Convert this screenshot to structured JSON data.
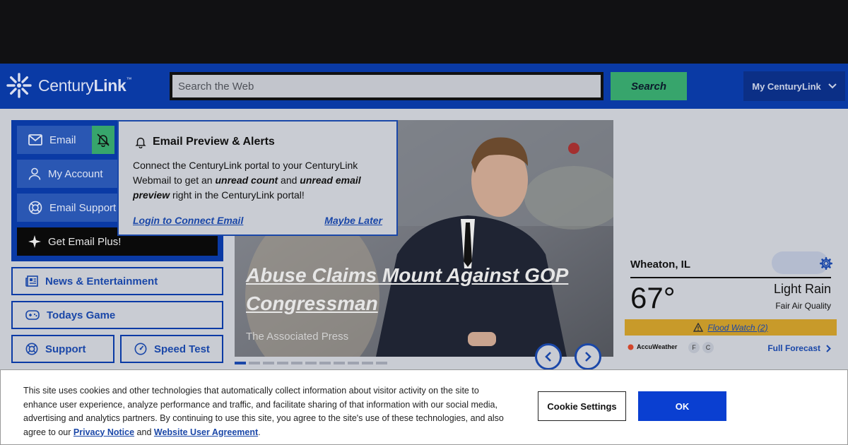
{
  "header": {
    "logo_text_light": "Century",
    "logo_text_bold": "Link",
    "logo_tm": "™",
    "search_placeholder": "Search the Web",
    "search_button": "Search",
    "account_menu": "My CenturyLink"
  },
  "left_panel": {
    "email": "Email",
    "my_account": "My Account",
    "email_support": "Email Support",
    "get_email_plus": "Get Email Plus!"
  },
  "quick_links": {
    "news": "News & Entertainment",
    "game": "Todays Game",
    "support": "Support",
    "speed_test": "Speed Test"
  },
  "email_popover": {
    "title": "Email Preview & Alerts",
    "body_1": "Connect the CenturyLink portal to your CenturyLink Webmail to get an ",
    "body_bold_1": "unread count",
    "body_2": " and ",
    "body_bold_2": "unread email preview",
    "body_3": " right in the CenturyLink portal!",
    "login_link": "Login to Connect Email",
    "later_link": "Maybe Later"
  },
  "hero": {
    "headline": "Abuse Claims Mount Against GOP Congressman",
    "source": "The Associated Press",
    "slide_count": 11,
    "active_slide": 1
  },
  "weather": {
    "location": "Wheaton, IL",
    "temperature": "67°",
    "condition": "Light Rain",
    "air_quality": "Fair Air Quality",
    "alert": "Flood Watch (2)",
    "provider": "AccuWeather",
    "unit_f": "F",
    "unit_c": "C",
    "full_forecast": "Full Forecast"
  },
  "cookie_banner": {
    "text": "This site uses cookies and other technologies that automatically collect information about visitor activity on the site to enhance user experience, analyze performance and traffic, and facilitate sharing of that information with our social media, advertising and analytics partners. By continuing to use this site, you agree to the site's use of these technologies, and also agree to our ",
    "privacy_link": "Privacy Notice",
    "and": " and ",
    "agreement_link": "Website User Agreement",
    "period": ".",
    "settings_button": "Cookie Settings",
    "ok_button": "OK"
  },
  "colors": {
    "brand_blue": "#0a3aa5",
    "search_green": "#37a56c",
    "alert_orange": "#c89a2a"
  }
}
